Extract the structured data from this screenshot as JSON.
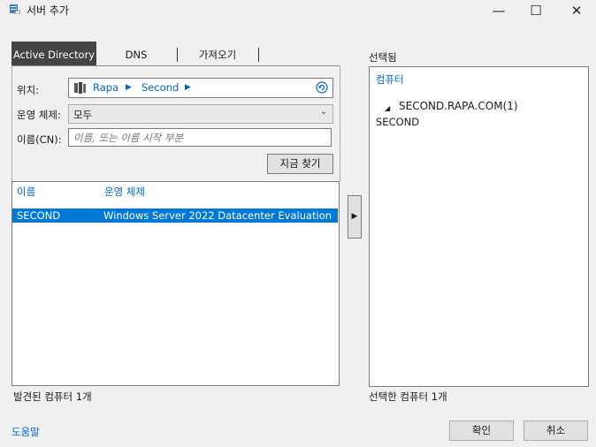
{
  "window": {
    "title": "서버 추가",
    "controls": {
      "minimize": "—",
      "maximize": "☐",
      "close": "✕"
    }
  },
  "tabs": [
    {
      "label": "Active Directory",
      "active": true
    },
    {
      "label": "DNS",
      "active": false
    },
    {
      "label": "가져오기",
      "active": false
    }
  ],
  "search": {
    "location_label": "위치:",
    "location_path": [
      "Rapa",
      "Second"
    ],
    "os_label": "운영 체제:",
    "os_value": "모두",
    "name_label": "이름(CN):",
    "name_placeholder": "이름, 또는 이름 시작 부분",
    "find_button": "지금 찾기"
  },
  "results": {
    "columns": [
      "이름",
      "운영 체제"
    ],
    "rows": [
      {
        "name": "SECOND",
        "os": "Windows Server 2022 Datacenter Evaluation",
        "selected": true
      }
    ],
    "footer": "발견된 컴퓨터 1개"
  },
  "selected": {
    "title": "선택됨",
    "column": "컴퓨터",
    "group": "SECOND.RAPA.COM(1)",
    "items": [
      "SECOND"
    ],
    "footer": "선택한 컴퓨터 1개"
  },
  "footer": {
    "help": "도움말",
    "ok": "확인",
    "cancel": "취소"
  },
  "colors": {
    "accent": "#0078d7",
    "link": "#0066cc",
    "tab_active": "#444444"
  }
}
